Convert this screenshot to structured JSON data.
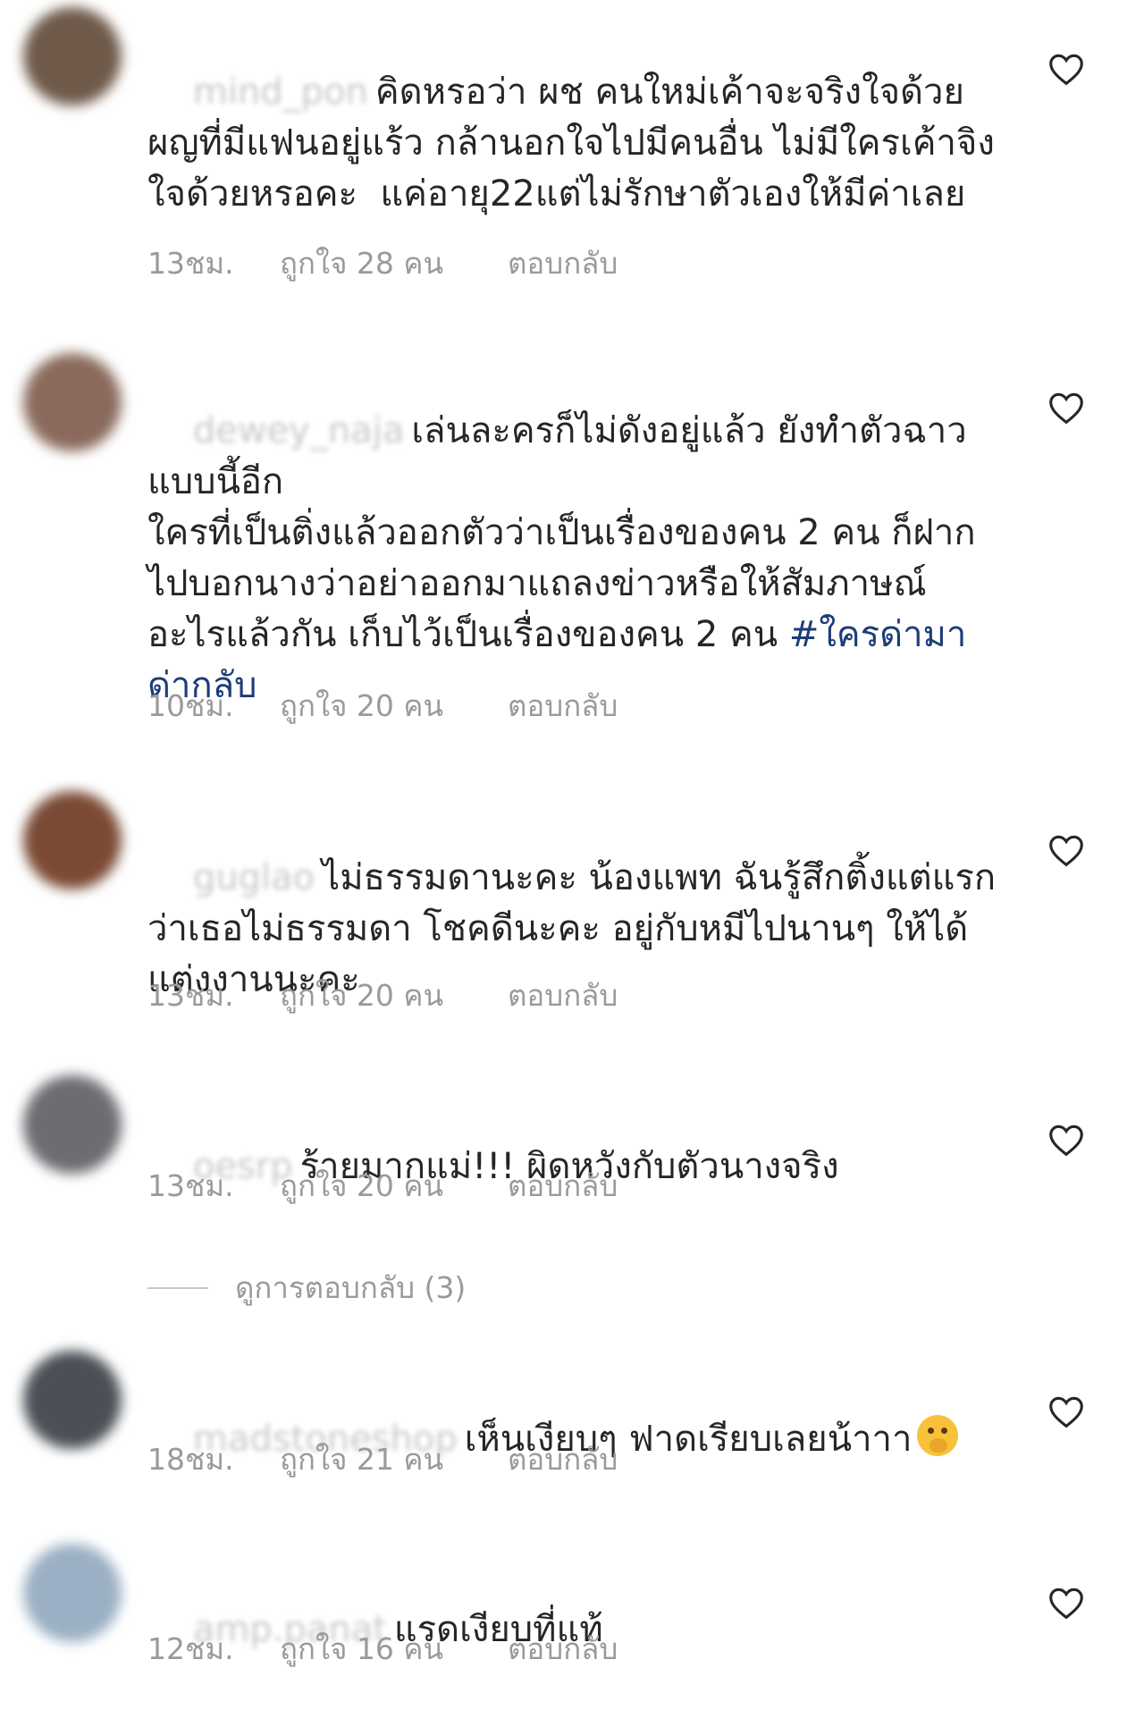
{
  "colors": {
    "text": "#262626",
    "meta": "#9a9a9a",
    "hashtag": "#1d3c78",
    "heart_stroke": "#262626"
  },
  "icons": {
    "heart": "heart-outline-icon",
    "emoji": "face-with-hand-over-mouth-emoji"
  },
  "comments": [
    {
      "username": "mind_pon",
      "text": "คิดหรอว่า ผช คนใหม่เค้าจะจริงใจด้วย\nผญที่มีแฟนอยู่แร้ว กล้านอกใจไปมีคนอื่น ไม่มีใครเค้าจิงใจด้วยหรอคะ  แค่อายุ22แต่ไม่รักษาตัวเองให้มีค่าเลย",
      "time": "13ชม.",
      "likes": "ถูกใจ 28 คน",
      "reply": "ตอบกลับ",
      "avatar_color": "#6f5a4a"
    },
    {
      "username": "dewey_naja",
      "text": "เล่นละครก็ไม่ดังอยู่แล้ว ยังทำตัวฉาวแบบนี้อีก\nใครที่เป็นติ่งแล้วออกตัวว่าเป็นเรื่องของคน 2 คน ก็ฝากไปบอกนางว่าอย่าออกมาแถลงข่าวหรือให้สัมภาษณ์อะไรแล้วกัน เก็บไว้เป็นเรื่องของคน 2 คน",
      "hashtag": "#ใครด่ามาด่ากลับ",
      "time": "10ชม.",
      "likes": "ถูกใจ 20 คน",
      "reply": "ตอบกลับ",
      "avatar_color": "#8a6a5c"
    },
    {
      "username": "guglao",
      "text": "ไม่ธรรมดานะคะ น้องแพท ฉันรู้สึกติ้งแต่แรกว่าเธอไม่ธรรมดา โชคดีนะคะ อยู่กับหมีไปนานๆ ให้ได้แต่งงานนะคะ",
      "time": "13ชม.",
      "likes": "ถูกใจ 20 คน",
      "reply": "ตอบกลับ",
      "avatar_color": "#7a4a34"
    },
    {
      "username": "oesrp",
      "text": "ร้ายมากแม่!!! ผิดหวังกับตัวนางจริง",
      "time": "13ชม.",
      "likes": "ถูกใจ 20 คน",
      "reply": "ตอบกลับ",
      "avatar_color": "#6c6c72"
    },
    {
      "username": "madstoneshop",
      "text": "เห็นเงียบๆ ฟาดเรียบเลยน้าาา",
      "time": "18ชม.",
      "likes": "ถูกใจ 21 คน",
      "reply": "ตอบกลับ",
      "avatar_color": "#4a5056"
    },
    {
      "username": "amp.panat",
      "text": "แรดเงียบที่แท้",
      "time": "12ชม.",
      "likes": "ถูกใจ 16 คน",
      "reply": "ตอบกลับ",
      "avatar_color": "#9bb0c4"
    }
  ],
  "view_replies": "ดูการตอบกลับ (3)"
}
